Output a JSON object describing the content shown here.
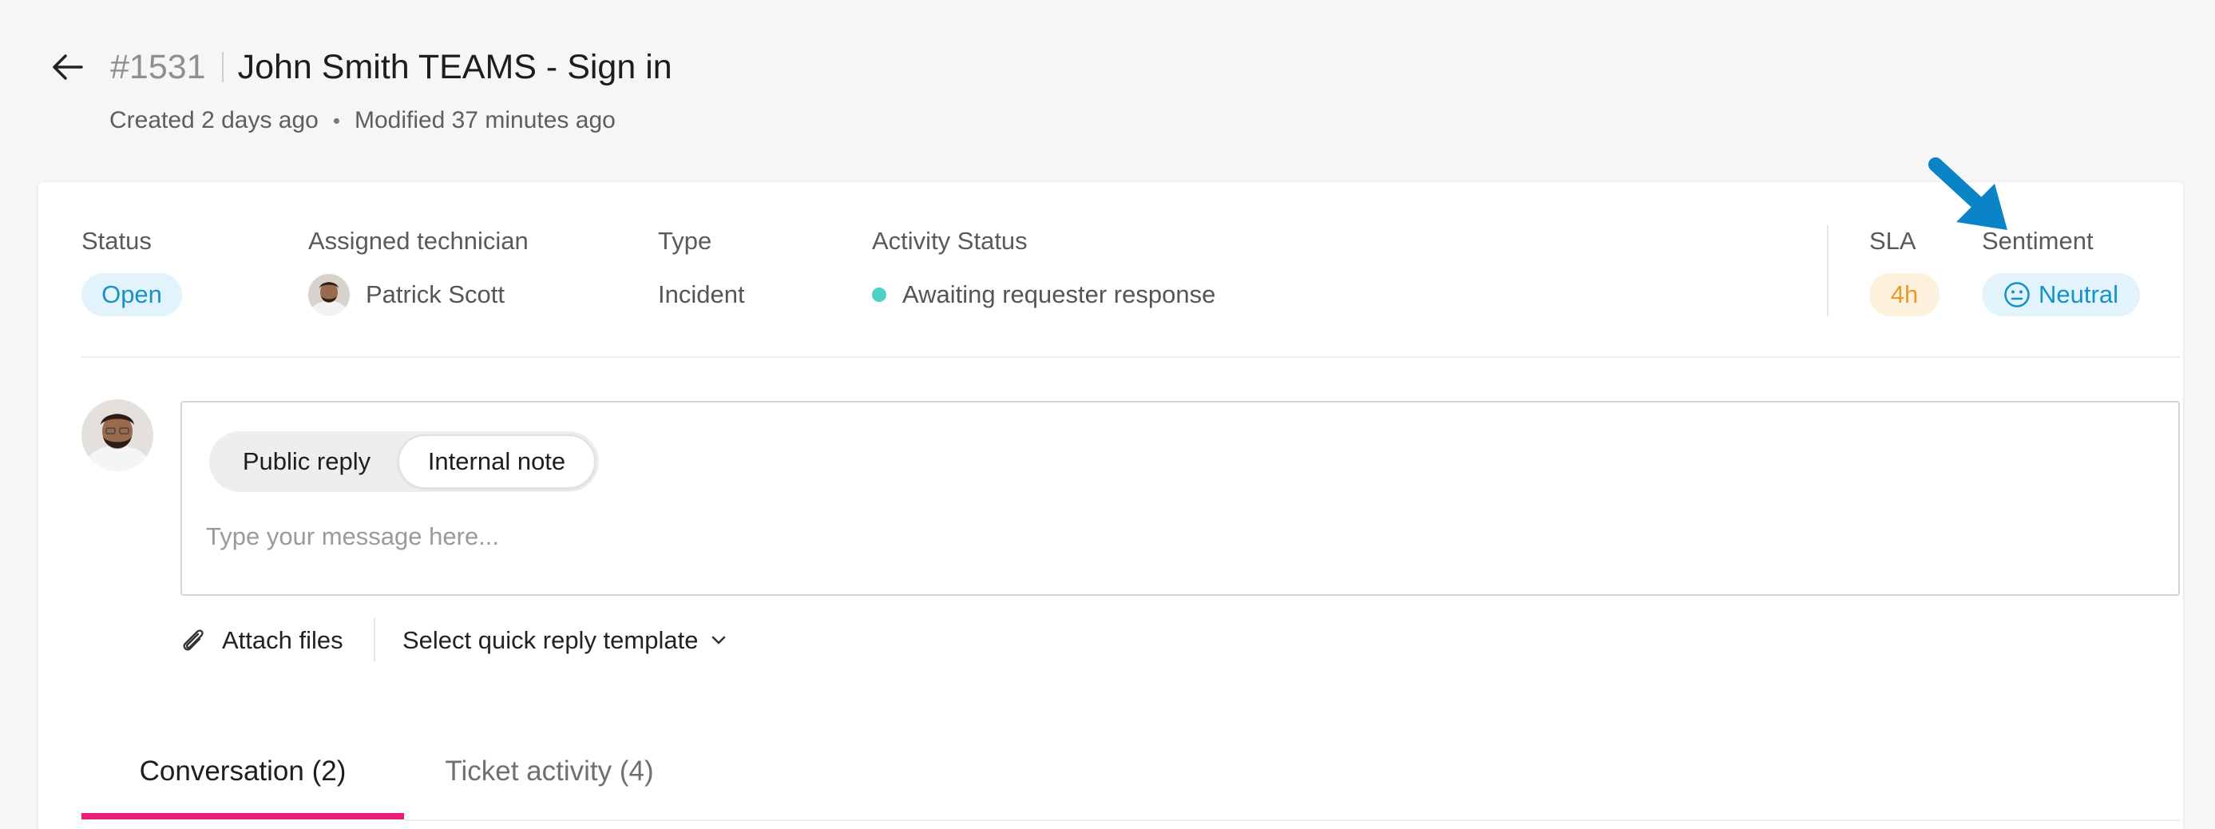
{
  "header": {
    "ticket_id": "#1531",
    "title": "John Smith TEAMS - Sign in",
    "created": "Created 2 days ago",
    "separator": "•",
    "modified": "Modified 37 minutes ago"
  },
  "fields": {
    "status": {
      "label": "Status",
      "value": "Open"
    },
    "technician": {
      "label": "Assigned technician",
      "value": "Patrick Scott"
    },
    "type": {
      "label": "Type",
      "value": "Incident"
    },
    "activity": {
      "label": "Activity Status",
      "value": "Awaiting requester response"
    },
    "sla": {
      "label": "SLA",
      "value": "4h"
    },
    "sentiment": {
      "label": "Sentiment",
      "value": "Neutral"
    }
  },
  "composer": {
    "tabs": {
      "public": "Public reply",
      "internal": "Internal note"
    },
    "active_tab": "internal",
    "placeholder": "Type your message here...",
    "value": ""
  },
  "tools": {
    "attach": "Attach files",
    "quick_reply": "Select quick reply template"
  },
  "tabs": {
    "conversation": "Conversation (2)",
    "activity": "Ticket activity (4)"
  },
  "colors": {
    "accent_blue": "#1792c9",
    "sla_orange": "#e89b2a",
    "status_dot": "#4fd1c5",
    "tab_underline": "#ec1f78",
    "annotation_arrow": "#0a84c6"
  },
  "icons": {
    "back": "arrow-left-icon",
    "sentiment": "neutral-face-icon",
    "attach": "paperclip-icon",
    "dropdown": "chevron-down-icon",
    "annotation": "annotation-arrow-icon"
  }
}
